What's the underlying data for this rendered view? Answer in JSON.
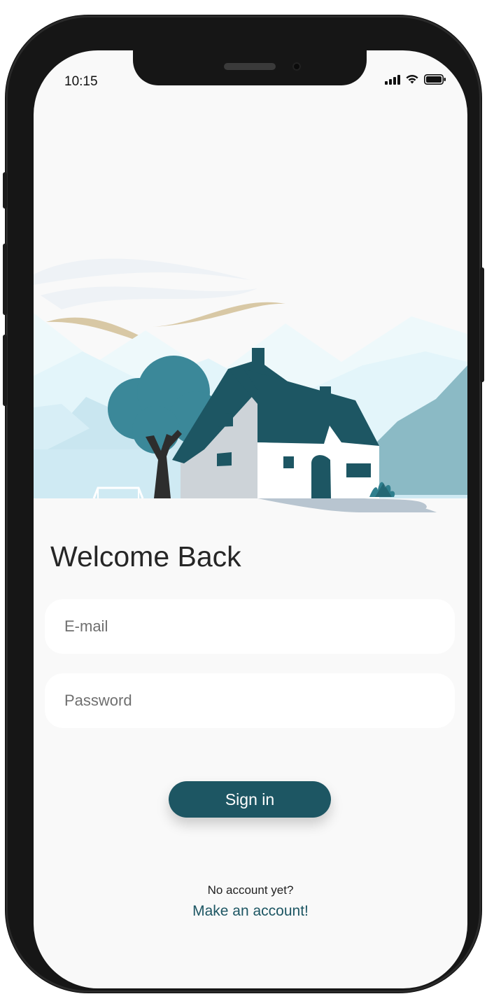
{
  "status_bar": {
    "time": "10:15",
    "icons": [
      "signal-icon",
      "wifi-icon",
      "battery-icon"
    ]
  },
  "welcome": {
    "title": "Welcome Back"
  },
  "form": {
    "email_placeholder": "E-mail",
    "email_value": "",
    "password_placeholder": "Password",
    "password_value": "",
    "signin_label": "Sign in"
  },
  "footer": {
    "prompt": "No account yet?",
    "link_label": "Make an account!"
  },
  "colors": {
    "primary": "#1d5663",
    "background": "#f9f9f9",
    "field_background": "#ffffff",
    "mountain_light": "#cfeaf3",
    "mountain_dark": "#8bbac5",
    "path": "#b8c5d0"
  }
}
